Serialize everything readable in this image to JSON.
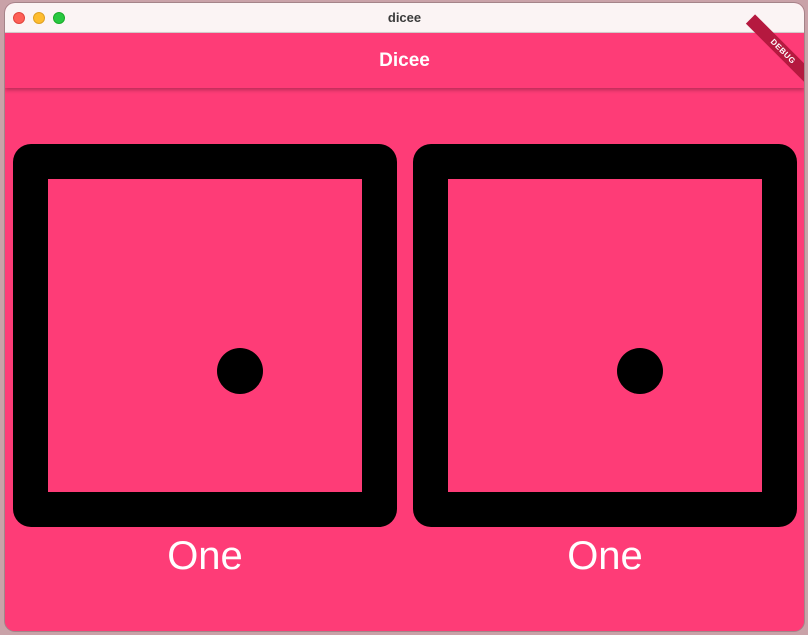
{
  "window": {
    "title": "dicee"
  },
  "appbar": {
    "title": "Dicee",
    "debug_banner": "DEBUG"
  },
  "dice": [
    {
      "face": 1,
      "label": "One"
    },
    {
      "face": 1,
      "label": "One"
    }
  ],
  "colors": {
    "background": "#fe3c77",
    "appbar": "#fe3c77",
    "die_outline": "#000000",
    "pip": "#000000",
    "text": "#ffffff",
    "debug_banner": "#b5193f"
  },
  "icons": {
    "close": "close-traffic-light-icon",
    "minimize": "minimize-traffic-light-icon",
    "zoom": "zoom-traffic-light-icon",
    "die": "die-face-one-icon"
  }
}
